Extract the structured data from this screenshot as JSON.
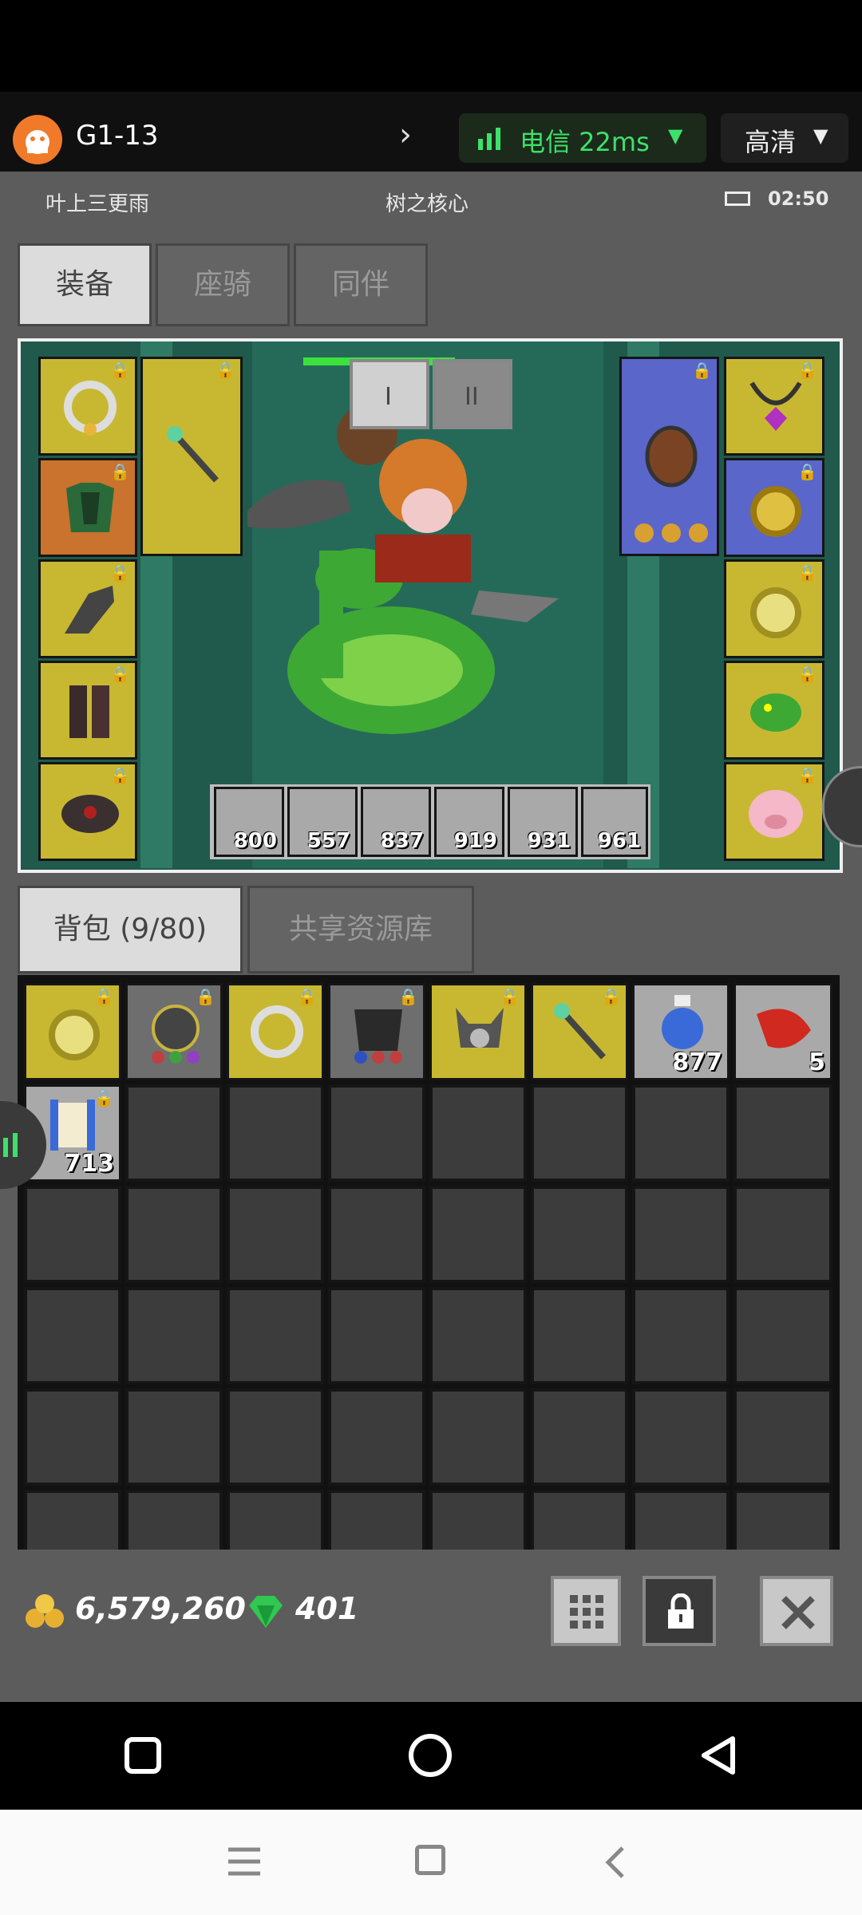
{
  "topbar": {
    "app_title": "G1-13",
    "network": "电信 22ms",
    "quality": "高清"
  },
  "status": {
    "player_name": "叶上三更雨",
    "location": "树之核心",
    "time": "02:50"
  },
  "equip_tabs": [
    {
      "label": "装备"
    },
    {
      "label": "座骑"
    },
    {
      "label": "同伴"
    }
  ],
  "preview_buttons": {
    "one": "I",
    "two": "II"
  },
  "consumables": [
    "800",
    "557",
    "837",
    "919",
    "931",
    "961"
  ],
  "inventory_tabs": {
    "bag": "背包 (9/80)",
    "shared": "共享资源库"
  },
  "inventory": {
    "potion_qty": "877",
    "feather_qty": "5",
    "scroll_qty": "713"
  },
  "currency": {
    "gold": "6,579,260",
    "gems": "401"
  },
  "equipment_slots": [
    {
      "side": "left",
      "icon": "ring-icon"
    },
    {
      "side": "left",
      "icon": "chest-armor-icon"
    },
    {
      "side": "left",
      "icon": "gloves-icon"
    },
    {
      "side": "left",
      "icon": "boots-icon"
    },
    {
      "side": "left",
      "icon": "belt-icon"
    },
    {
      "side": "left",
      "icon": "wand-icon"
    },
    {
      "side": "right",
      "icon": "shield-icon"
    },
    {
      "side": "right",
      "icon": "amulet-icon"
    },
    {
      "side": "right",
      "icon": "gold-ring-icon"
    },
    {
      "side": "right",
      "icon": "gold-ring-2-icon"
    },
    {
      "side": "right",
      "icon": "snake-mount-icon"
    },
    {
      "side": "right",
      "icon": "pig-pet-icon"
    }
  ]
}
